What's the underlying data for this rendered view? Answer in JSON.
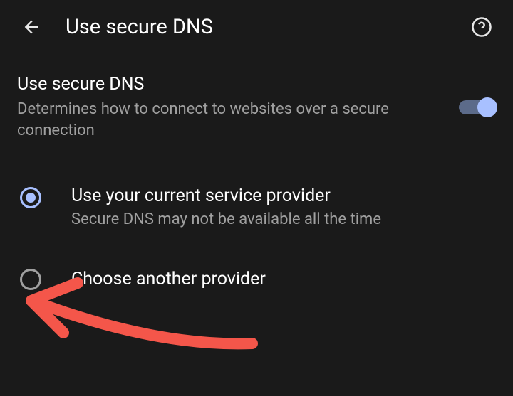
{
  "header": {
    "title": "Use secure DNS"
  },
  "toggle": {
    "title": "Use secure DNS",
    "subtitle": "Determines how to connect to websites over a secure connection",
    "enabled": true
  },
  "options": {
    "current_provider": {
      "title": "Use your current service provider",
      "subtitle": "Secure DNS may not be available all the time",
      "selected": true
    },
    "another_provider": {
      "title": "Choose another provider",
      "selected": false
    }
  },
  "colors": {
    "background": "#1a1a1a",
    "accent": "#a8c0ff",
    "text_primary": "#ffffff",
    "text_secondary": "#a0a0a0",
    "annotation": "#f4564a"
  }
}
